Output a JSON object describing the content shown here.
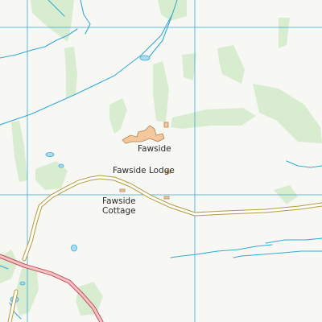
{
  "map": {
    "colors": {
      "background": "#f7f7f4",
      "woodland": "#d8edcf",
      "water": "#35a9d6",
      "grid": "#35a9d6",
      "building": "#f2c89c",
      "building_outline": "#b08552",
      "minor_road_fill": "#ffffff",
      "minor_road_casing": "#b59a3a",
      "major_road_fill": "#f6c3c6",
      "major_road_casing": "#c0505a"
    },
    "features": [
      {
        "id": "woodland",
        "kind": "woodland"
      },
      {
        "id": "streams",
        "kind": "water"
      },
      {
        "id": "ponds",
        "kind": "water"
      },
      {
        "id": "grid-lines",
        "kind": "grid"
      },
      {
        "id": "buildings",
        "kind": "building"
      },
      {
        "id": "minor-roads",
        "kind": "minor road"
      },
      {
        "id": "main-road",
        "kind": "main road"
      }
    ],
    "labels": {
      "fawside": "Fawside",
      "fawside_lodge": "Fawside Lodge",
      "fawside_cottage_line1": "Fawside",
      "fawside_cottage_line2": "Cottage"
    }
  }
}
